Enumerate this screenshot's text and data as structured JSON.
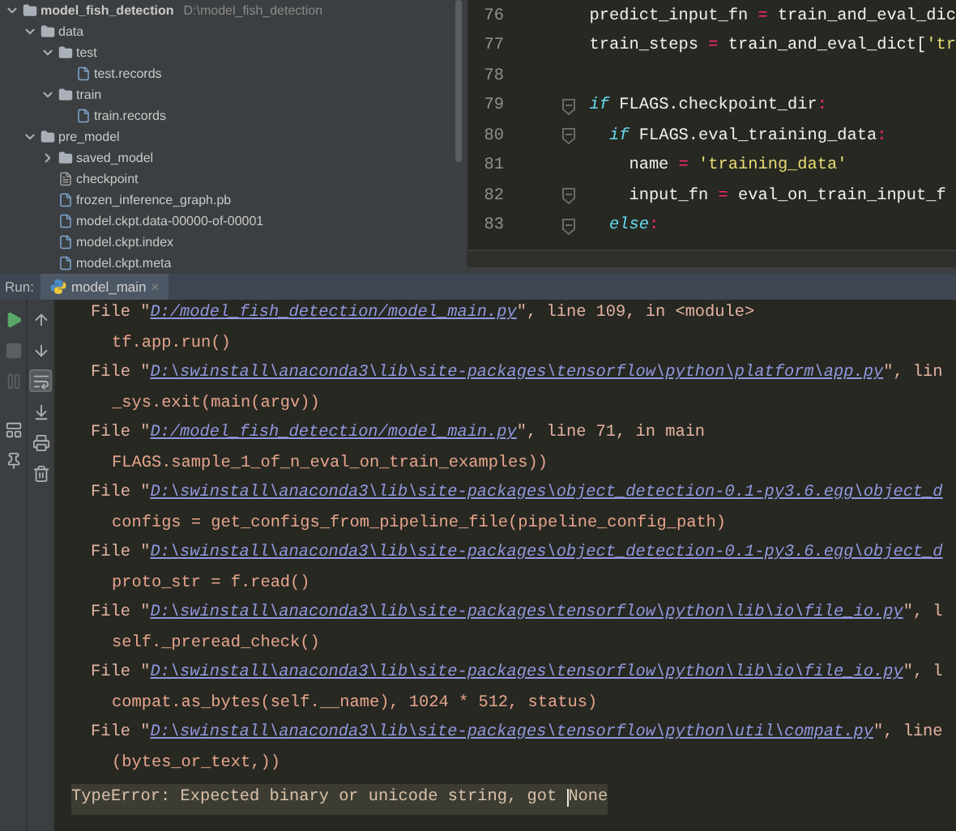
{
  "project_tree": [
    {
      "name": "model_fish_detection",
      "path": "D:\\model_fish_detection",
      "kind": "folder",
      "expanded": true,
      "children": [
        {
          "name": "data",
          "kind": "folder",
          "expanded": true,
          "children": [
            {
              "name": "test",
              "kind": "folder",
              "expanded": true,
              "children": [
                {
                  "name": "test.records",
                  "kind": "data-file"
                }
              ]
            },
            {
              "name": "train",
              "kind": "folder",
              "expanded": true,
              "children": [
                {
                  "name": "train.records",
                  "kind": "data-file"
                }
              ]
            }
          ]
        },
        {
          "name": "pre_model",
          "kind": "folder",
          "expanded": true,
          "children": [
            {
              "name": "saved_model",
              "kind": "folder",
              "expanded": false
            },
            {
              "name": "checkpoint",
              "kind": "text-file"
            },
            {
              "name": "frozen_inference_graph.pb",
              "kind": "data-file"
            },
            {
              "name": "model.ckpt.data-00000-of-00001",
              "kind": "data-file"
            },
            {
              "name": "model.ckpt.index",
              "kind": "data-file"
            },
            {
              "name": "model.ckpt.meta",
              "kind": "data-file"
            }
          ]
        }
      ]
    }
  ],
  "editor": {
    "lines": [
      {
        "number": "76",
        "tokens": [
          {
            "kind": "plain",
            "text": "predict_input_fn "
          },
          {
            "kind": "op",
            "text": "="
          },
          {
            "kind": "plain",
            "text": " train_and_eval_dic"
          }
        ]
      },
      {
        "number": "77",
        "tokens": [
          {
            "kind": "plain",
            "text": "train_steps "
          },
          {
            "kind": "op",
            "text": "="
          },
          {
            "kind": "plain",
            "text": " train_and_eval_dict["
          },
          {
            "kind": "string",
            "text": "'tr"
          }
        ]
      },
      {
        "number": "78"
      },
      {
        "number": "79",
        "fold": true,
        "tokens": [
          {
            "kind": "keyword",
            "text": "if"
          },
          {
            "kind": "plain",
            "text": " FLAGS.checkpoint_dir"
          },
          {
            "kind": "op",
            "text": ":"
          }
        ]
      },
      {
        "number": "80",
        "fold": true,
        "tokens": [
          {
            "kind": "keyword",
            "text": "  if"
          },
          {
            "kind": "plain",
            "text": " FLAGS.eval_training_data"
          },
          {
            "kind": "op",
            "text": ":"
          }
        ]
      },
      {
        "number": "81",
        "tokens": [
          {
            "kind": "plain",
            "text": "    name "
          },
          {
            "kind": "op",
            "text": "="
          },
          {
            "kind": "string",
            "text": " 'training_data'"
          }
        ]
      },
      {
        "number": "82",
        "fold": true,
        "tokens": [
          {
            "kind": "plain",
            "text": "    input_fn "
          },
          {
            "kind": "op",
            "text": "="
          },
          {
            "kind": "plain",
            "text": " eval_on_train_input_f"
          }
        ]
      },
      {
        "number": "83",
        "fold": true,
        "tokens": [
          {
            "kind": "keyword",
            "text": "  else"
          },
          {
            "kind": "op",
            "text": ":"
          }
        ]
      }
    ]
  },
  "run_panel": {
    "label": "Run:",
    "tabs": [
      {
        "title": "model_main",
        "close": "×",
        "selected": true
      }
    ],
    "left_toolbar": [
      {
        "kind": "run",
        "disabled": false
      },
      {
        "kind": "stop",
        "disabled": true
      },
      {
        "kind": "pause",
        "disabled": true
      },
      {
        "kind": "layout",
        "disabled": false
      },
      {
        "kind": "pin",
        "disabled": false
      }
    ],
    "console_toolbar": [
      {
        "kind": "up",
        "selected": false
      },
      {
        "kind": "down",
        "selected": false
      },
      {
        "kind": "wrap",
        "selected": true
      },
      {
        "kind": "scroll-end",
        "selected": false
      },
      {
        "kind": "print",
        "selected": false
      },
      {
        "kind": "clear",
        "selected": false
      }
    ],
    "console": [
      {
        "kind": "file",
        "prefix": "File \"",
        "path": "D:/model_fish_detection/model_main.py",
        "suffix": "\", line 109, in <module>"
      },
      {
        "kind": "code",
        "text": "tf.app.run()"
      },
      {
        "kind": "file",
        "prefix": "File \"",
        "path": "D:\\swinstall\\anaconda3\\lib\\site-packages\\tensorflow\\python\\platform\\app.py",
        "suffix": "\", lin"
      },
      {
        "kind": "code",
        "text": "_sys.exit(main(argv))"
      },
      {
        "kind": "file",
        "prefix": "File \"",
        "path": "D:/model_fish_detection/model_main.py",
        "suffix": "\", line 71, in main"
      },
      {
        "kind": "code",
        "text": "FLAGS.sample_1_of_n_eval_on_train_examples))"
      },
      {
        "kind": "file",
        "prefix": "File \"",
        "path": "D:\\swinstall\\anaconda3\\lib\\site-packages\\object_detection-0.1-py3.6.egg\\object_d"
      },
      {
        "kind": "code",
        "text": "configs = get_configs_from_pipeline_file(pipeline_config_path)"
      },
      {
        "kind": "file",
        "prefix": "File \"",
        "path": "D:\\swinstall\\anaconda3\\lib\\site-packages\\object_detection-0.1-py3.6.egg\\object_d"
      },
      {
        "kind": "code",
        "text": "proto_str = f.read()"
      },
      {
        "kind": "file",
        "prefix": "File \"",
        "path": "D:\\swinstall\\anaconda3\\lib\\site-packages\\tensorflow\\python\\lib\\io\\file_io.py",
        "suffix": "\", l"
      },
      {
        "kind": "code",
        "text": "self._preread_check()"
      },
      {
        "kind": "file",
        "prefix": "File \"",
        "path": "D:\\swinstall\\anaconda3\\lib\\site-packages\\tensorflow\\python\\lib\\io\\file_io.py",
        "suffix": "\", l"
      },
      {
        "kind": "code",
        "text": "compat.as_bytes(self.__name), 1024 * 512, status)"
      },
      {
        "kind": "file",
        "prefix": "File \"",
        "path": "D:\\swinstall\\anaconda3\\lib\\site-packages\\tensorflow\\python\\util\\compat.py",
        "suffix": "\", line"
      },
      {
        "kind": "code",
        "text": "(bytes_or_text,))"
      },
      {
        "kind": "error",
        "text": "TypeError: Expected binary or unicode string, got ",
        "text_at_cursor": "None"
      }
    ]
  }
}
